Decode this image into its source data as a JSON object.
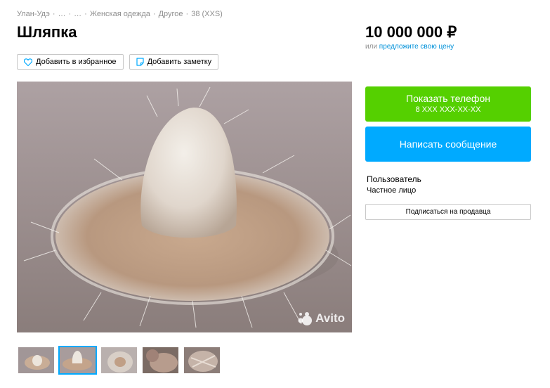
{
  "breadcrumbs": [
    "Улан-Удэ",
    "…",
    "…",
    "Женская одежда",
    "Другое",
    "38 (XXS)"
  ],
  "breadcrumb_separator": "·",
  "title": "Шляпка",
  "actions": {
    "favorite_label": "Добавить в избранное",
    "note_label": "Добавить заметку"
  },
  "photo": {
    "watermark": "Avito",
    "thumbnails_count": 5,
    "active_thumbnail": 2
  },
  "price": {
    "value": "10 000 000 ₽",
    "prefix": "или",
    "offer_link": "предложите свою цену"
  },
  "contact": {
    "show_phone_label": "Показать телефон",
    "phone_masked": "8 XXX XXX-XX-XX",
    "message_label": "Написать сообщение"
  },
  "seller": {
    "name": "Пользователь",
    "type": "Частное лицо",
    "subscribe_label": "Подписаться на продавца"
  },
  "colors": {
    "green": "#55d000",
    "blue": "#00aaff",
    "link": "#0091d9"
  },
  "icons": [
    "heart-icon",
    "note-icon",
    "avito-logo-icon"
  ]
}
